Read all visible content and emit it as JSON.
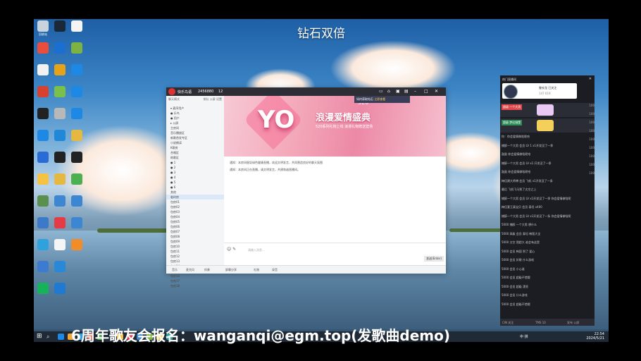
{
  "banner_title": "钻石双倍",
  "caption": "6周年歌友会报名：wanganqi@egm.top(发歌曲demo)",
  "desktop": {
    "icons": [
      {
        "label": "回收站",
        "color": "#c9d3dd"
      },
      {
        "label": "",
        "color": "#e94d3c"
      },
      {
        "label": "",
        "color": "#f2f2f2"
      },
      {
        "label": "",
        "color": "#d8412f"
      },
      {
        "label": "",
        "color": "#222"
      },
      {
        "label": "",
        "color": "#1e88e5"
      },
      {
        "label": "",
        "color": "#2b6bd6"
      },
      {
        "label": "",
        "color": "#f6c244"
      },
      {
        "label": "",
        "color": "#5a8f4e"
      },
      {
        "label": "",
        "color": "#3d79c9"
      },
      {
        "label": "",
        "color": "#2fa1dc"
      },
      {
        "label": "",
        "color": "#3d7bd1"
      },
      {
        "label": "",
        "color": "#16b35b"
      },
      {
        "label": "",
        "color": "#1b2838"
      },
      {
        "label": "",
        "color": "#1b6fd0"
      },
      {
        "label": "",
        "color": "#e6a31a"
      },
      {
        "label": "",
        "color": "#79c14a"
      },
      {
        "label": "",
        "color": "#b8b8b8"
      },
      {
        "label": "",
        "color": "#1f88d8"
      },
      {
        "label": "",
        "color": "#222"
      },
      {
        "label": "",
        "color": "#e5b842"
      },
      {
        "label": "",
        "color": "#3d86d1"
      },
      {
        "label": "",
        "color": "#e53b46"
      },
      {
        "label": "",
        "color": "#f5f5f5"
      },
      {
        "label": "",
        "color": "#2a88d8"
      },
      {
        "label": "",
        "color": "#1f7ad4"
      },
      {
        "label": "",
        "color": "#f5f5f5"
      },
      {
        "label": "",
        "color": "#7cb342"
      },
      {
        "label": "",
        "color": "#1e88e5"
      },
      {
        "label": "",
        "color": "#1e88e5"
      },
      {
        "label": "",
        "color": "#1e88e5"
      },
      {
        "label": "",
        "color": "#e5b842"
      },
      {
        "label": "",
        "color": "#222"
      },
      {
        "label": "",
        "color": "#4caf50"
      },
      {
        "label": "",
        "color": "#3d86d1"
      },
      {
        "label": "",
        "color": "#3d86d1"
      },
      {
        "label": "",
        "color": "#f08c2a"
      }
    ]
  },
  "chat_window": {
    "title_name": "快乐鸟语",
    "room_id": "2456880",
    "user_count": "12",
    "sidebar_header_left": "聊天模式",
    "sidebar_header_right": "排队 公屏 设置",
    "sidebar_items": [
      "▾ 麦序用户",
      "  ● 乐鸟",
      "  ● 用户",
      "▸ 公屏",
      "  主房间",
      "  音乐播放区",
      "  新歌首发专区",
      "  小说朗读",
      "  K歌房",
      "  合唱区",
      "  练歌区",
      "  ● 1",
      "  ● 2",
      "  ● 3",
      "  ● 4",
      "  ● 5",
      "  ● 6",
      "  其他",
      "  临时房",
      "  包房01",
      "  包房02",
      "  包房03",
      "  包房04",
      "  包房05",
      "  包房06",
      "  包房07",
      "  包房08",
      "  包房09",
      "  包房10",
      "  包房11",
      "  包房12",
      "  包房13",
      "  包房14",
      "  包房15",
      "  包房16",
      "  包房17",
      "  包房18"
    ],
    "banner": {
      "yo": "YO",
      "title": "浪漫爱情盛典",
      "sub": "520系列礼物上线  浪漫礼物赠送登场",
      "big": "520",
      "popup_text": "如何获取钻石",
      "popup_link": "立即查看"
    },
    "chat_lines": [
      "通知：本房间倡导绿色健康直播，欢迎文明发言，共同营造良好的聊天氛围",
      "通知：本房间正在直播，请文明发言，共建和谐直播间。"
    ],
    "input_placeholder": "请输入消息...",
    "send_label": "发送(Enter)",
    "bottom_items": [
      "音乐",
      "麦克风",
      "伴奏",
      "屏幕分享",
      "礼物",
      "录音"
    ]
  },
  "right_panel": {
    "header": "热门直播间",
    "profile_name": "鲁钦龙 已关注",
    "profile_sub": "147 619",
    "cards": [
      {
        "label": "超级 一个大男",
        "gift_color": "#e9c8f4"
      },
      {
        "label": "超级 梦幻城堡",
        "gift_color": "#f4cf5a"
      }
    ],
    "messages": [
      "你：你会爱情做啥呢哈",
      "捕醉一个大男 会员 LV 1 x1开发没了一季",
      "鼓励 你会爱情做啥呢哈",
      "捕醉一个大男 会员 LV x1 开发没了一季",
      "鼓励 你会爱情做啥呢哈",
      "梅伍建大师傅 会员 飞机 x1开发没了一条",
      "最后 飞机飞马到了太空之上",
      "捕醉一个大男 会员 LV x1开发没了一季 你会爱情做啥呢",
      "梅伍萱王真宝贝 会员 泰坦 x400",
      "捕醉一个大男 会员 LV x1开发没了一条 你会爱情做啥呢",
      "5000 捕醉 一个大男 想什么",
      "5000 高级 会员 泰坦 韩版大全",
      "5000 太空 我超大 谁会有这是",
      "5000 会员 韩国 到了 爱心",
      "5000 会员 好歌 什么游戏",
      "5000 会员 小心谁",
      "5000 会员 超级不错哦",
      "5000 会员 超级 漂亮",
      "5000 会员 什么游戏",
      "5000 会员 超级不错哦"
    ],
    "side_values": [
      "100",
      "100",
      "100",
      "100",
      "100",
      "100",
      "100",
      "100",
      "100"
    ],
    "footer": [
      "CIN 关注",
      "TMS 10",
      "发布 公屏"
    ]
  },
  "taskbar": {
    "tray": "中 拼",
    "time": "22:54",
    "date": "2024/5/21"
  }
}
